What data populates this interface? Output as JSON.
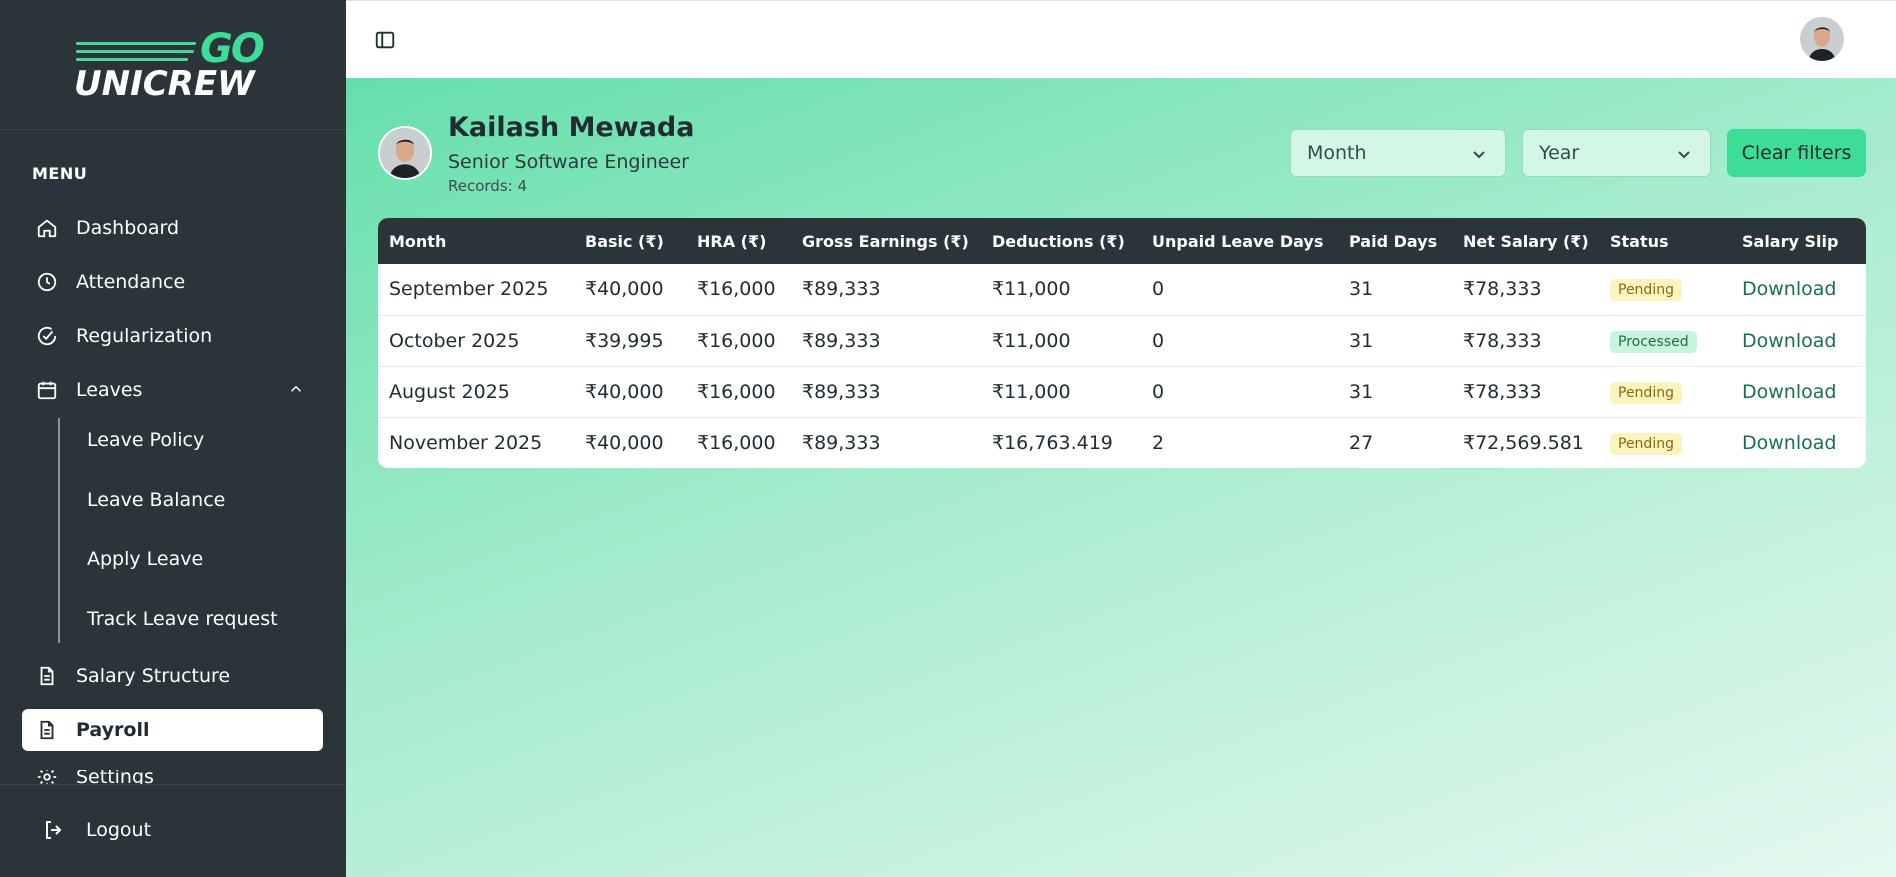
{
  "brand": {
    "logo_top": "GO",
    "logo_bottom": "UNICREW"
  },
  "sidebar": {
    "menu_label": "MENU",
    "items": [
      {
        "label": "Dashboard",
        "icon": "home-icon"
      },
      {
        "label": "Attendance",
        "icon": "clock-icon"
      },
      {
        "label": "Regularization",
        "icon": "check-circle-icon"
      },
      {
        "label": "Leaves",
        "icon": "calendar-icon",
        "expanded": true
      },
      {
        "label": "Salary Structure",
        "icon": "document-icon"
      },
      {
        "label": "Payroll",
        "icon": "document-icon",
        "active": true
      }
    ],
    "sub_items": [
      "Leave Policy",
      "Leave Balance",
      "Apply Leave",
      "Track Leave request"
    ],
    "clipped_item": "Settings",
    "logout_label": "Logout"
  },
  "employee": {
    "name": "Kailash Mewada",
    "role": "Senior Software Engineer",
    "records": "Records: 4"
  },
  "filters": {
    "month": "Month",
    "year": "Year",
    "clear_label": "Clear filters"
  },
  "table": {
    "headers": [
      "Month",
      "Basic (₹)",
      "HRA (₹)",
      "Gross Earnings (₹)",
      "Deductions (₹)",
      "Unpaid Leave Days",
      "Paid Days",
      "Net Salary (₹)",
      "Status",
      "Salary Slip"
    ],
    "rows": [
      {
        "month": "September 2025",
        "basic": "₹40,000",
        "hra": "₹16,000",
        "gross": "₹89,333",
        "deductions": "₹11,000",
        "unpaid": "0",
        "paid": "31",
        "net": "₹78,333",
        "status": "Pending",
        "slip": "Download"
      },
      {
        "month": "October 2025",
        "basic": "₹39,995",
        "hra": "₹16,000",
        "gross": "₹89,333",
        "deductions": "₹11,000",
        "unpaid": "0",
        "paid": "31",
        "net": "₹78,333",
        "status": "Processed",
        "slip": "Download"
      },
      {
        "month": "August 2025",
        "basic": "₹40,000",
        "hra": "₹16,000",
        "gross": "₹89,333",
        "deductions": "₹11,000",
        "unpaid": "0",
        "paid": "31",
        "net": "₹78,333",
        "status": "Pending",
        "slip": "Download"
      },
      {
        "month": "November 2025",
        "basic": "₹40,000",
        "hra": "₹16,000",
        "gross": "₹89,333",
        "deductions": "₹16,763.419",
        "unpaid": "2",
        "paid": "27",
        "net": "₹72,569.581",
        "status": "Pending",
        "slip": "Download"
      }
    ]
  },
  "colors": {
    "sidebar_bg": "#2a3439",
    "accent": "#3ddc97",
    "pending_bg": "#fdf3bf",
    "processed_bg": "#c8f3dd"
  }
}
